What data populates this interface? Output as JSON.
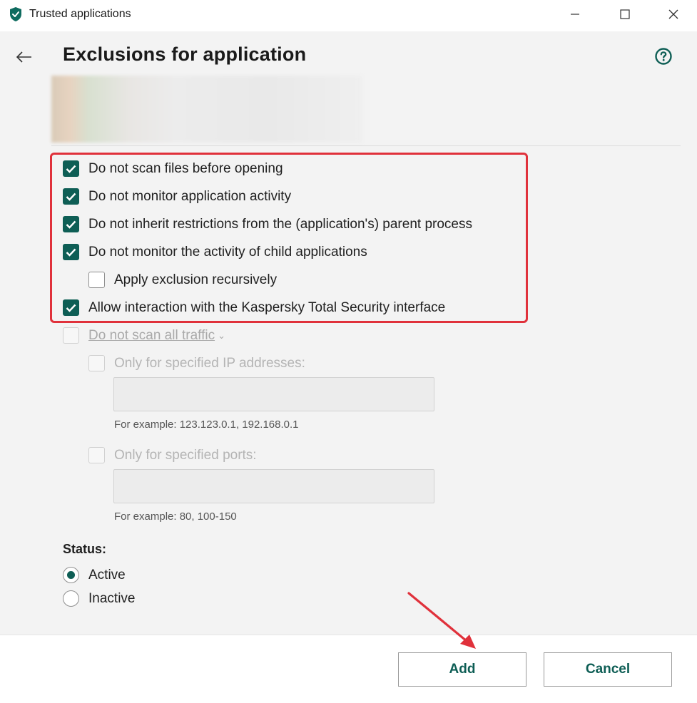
{
  "window": {
    "title": "Trusted applications"
  },
  "page": {
    "title": "Exclusions for application"
  },
  "options": [
    {
      "label": "Do not scan files before opening",
      "checked": true
    },
    {
      "label": "Do not monitor application activity",
      "checked": true
    },
    {
      "label": "Do not inherit restrictions from the (application's) parent process",
      "checked": true
    },
    {
      "label": "Do not monitor the activity of child applications",
      "checked": true
    },
    {
      "label": "Apply exclusion recursively",
      "checked": false
    },
    {
      "label": "Allow interaction with the Kaspersky Total Security interface",
      "checked": true
    }
  ],
  "traffic": {
    "label": "Do not scan all traffic",
    "checked": false,
    "ip": {
      "label": "Only for specified IP addresses:",
      "value": "",
      "hint": "For example: 123.123.0.1, 192.168.0.1"
    },
    "ports": {
      "label": "Only for specified ports:",
      "value": "",
      "hint": "For example: 80, 100-150"
    }
  },
  "status": {
    "label": "Status:",
    "options": [
      {
        "label": "Active",
        "selected": true
      },
      {
        "label": "Inactive",
        "selected": false
      }
    ]
  },
  "footer": {
    "add_label": "Add",
    "cancel_label": "Cancel"
  },
  "colors": {
    "accent": "#0e5e55",
    "highlight": "#e0313b"
  }
}
